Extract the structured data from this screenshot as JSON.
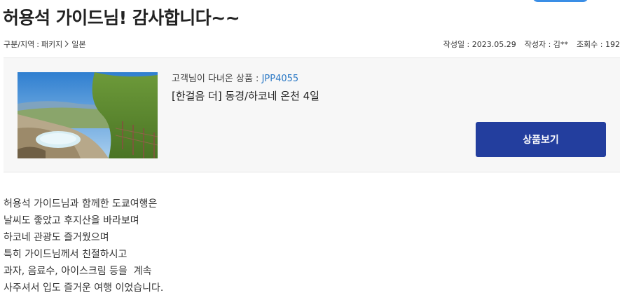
{
  "post": {
    "title": "허용석 가이드님! 감사합니다~~",
    "category_label": "구분/지역",
    "category_sep": ":",
    "category_value": "패키지",
    "region_value": "일본",
    "date_label": "작성일 : 2023.05.29",
    "author_label": "작성자 : 김**",
    "views_label": "조회수 : 192"
  },
  "product": {
    "intro_label": "고객님이 다녀온 상품 :",
    "code": "JPP4055",
    "name": "[한걸음 더] 동경/하코네 온천 4일",
    "view_button_label": "상품보기",
    "thumbnail_icon": "hot-spring-landscape-image"
  },
  "content": {
    "lines": [
      "허용석 가이드님과 함께한 도쿄여행은",
      "날씨도 좋았고 후지산을 바라보며",
      "하코네 관광도 즐거웠으며",
      "특히 가이드님께서 친절하시고",
      "과자, 음료수, 아이스크림 등을  계속",
      "사주셔서 입도 즐거운 여행 이었습니다."
    ]
  },
  "colors": {
    "button_bg": "#233e9e",
    "code_link": "#2a78c5",
    "card_bg": "#f7f7f7"
  }
}
